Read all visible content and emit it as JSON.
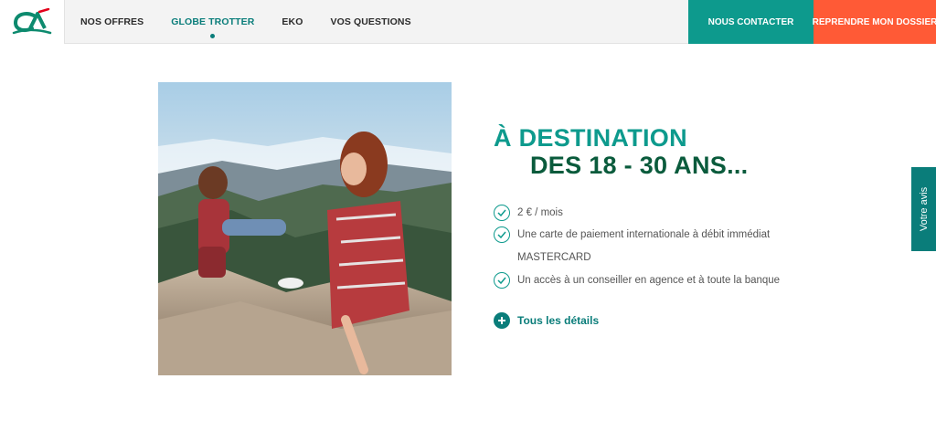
{
  "header": {
    "nav": [
      "NOS OFFRES",
      "GLOBE TROTTER",
      "EKO",
      "VOS QUESTIONS"
    ],
    "contact_label": "NOUS CONTACTER",
    "resume_label": "REPRENDRE MON DOSSIER"
  },
  "hero": {
    "title_line1": "À DESTINATION",
    "title_line2": "DES 18 - 30 ANS...",
    "features": [
      "2 € / mois",
      "Une carte de paiement internationale à débit immédiat",
      "Un accès à un conseiller en agence et à toute la banque"
    ],
    "feature_sub": "MASTERCARD",
    "details_label": "Tous les détails"
  },
  "feedback_label": "Votre avis",
  "colors": {
    "teal": "#0d9a8d",
    "dark_green": "#0a5b3c",
    "orange": "#ff5a36",
    "active_nav": "#0a7d7a"
  },
  "icons": {
    "logo": "credit-agricole-logo",
    "check": "check-circle-icon",
    "plus": "plus-circle-icon"
  }
}
